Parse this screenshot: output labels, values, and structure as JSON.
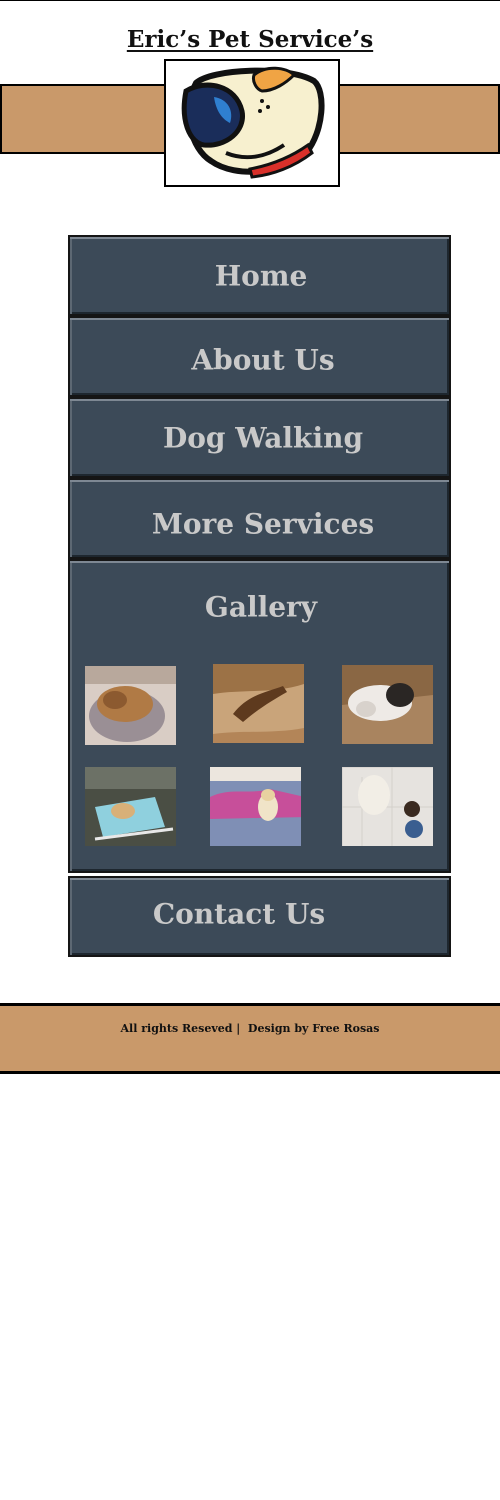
{
  "header": {
    "site_title": "Eric’s Pet Service’s",
    "logo_icon": "dog-head-logo-icon",
    "banner_color": "#c9996a"
  },
  "nav": {
    "background_color": "#3c4a58",
    "text_color": "#c9c9c9",
    "items": [
      {
        "label": "Home"
      },
      {
        "label": "About Us"
      },
      {
        "label": "Dog Walking"
      },
      {
        "label": "More Services"
      },
      {
        "label": "Gallery"
      },
      {
        "label": "Contact Us"
      }
    ]
  },
  "gallery": {
    "images": [
      {
        "icon": "dog-curled-on-blanket-photo"
      },
      {
        "icon": "dog-on-leather-couch-photo"
      },
      {
        "icon": "bulldog-lying-photo"
      },
      {
        "icon": "dog-on-patio-chair-photo"
      },
      {
        "icon": "dog-on-bed-photo"
      },
      {
        "icon": "dog-with-food-bowls-photo"
      }
    ]
  },
  "footer": {
    "text": "All rights Reseved |  Design by Free Rosas",
    "background_color": "#c9996a"
  }
}
